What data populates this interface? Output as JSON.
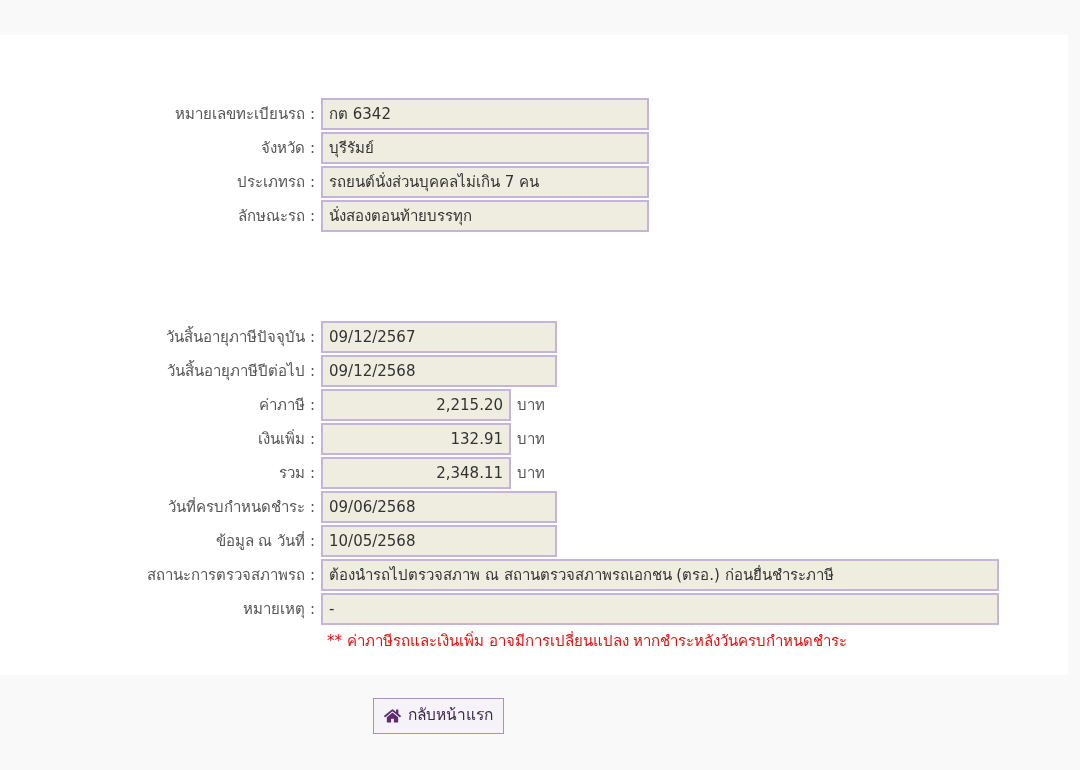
{
  "vehicle": {
    "fields": [
      {
        "label": "หมายเลขทะเบียนรถ :",
        "value": "กต 6342",
        "kind": "medium"
      },
      {
        "label": "จังหวัด :",
        "value": "บุรีรัมย์",
        "kind": "medium"
      },
      {
        "label": "ประเภทรถ :",
        "value": "รถยนต์นั่งส่วนบุคคลไม่เกิน 7 คน",
        "kind": "medium"
      },
      {
        "label": "ลักษณะรถ :",
        "value": "นั่งสองตอนท้ายบรรทุก",
        "kind": "medium"
      }
    ]
  },
  "tax": {
    "fields": [
      {
        "label": "วันสิ้นอายุภาษีปัจจุบัน :",
        "value": "09/12/2567",
        "kind": "date"
      },
      {
        "label": "วันสิ้นอายุภาษีปีต่อไป :",
        "value": "09/12/2568",
        "kind": "date"
      },
      {
        "label": "ค่าภาษี :",
        "value": "2,215.20",
        "kind": "amount",
        "unit": "บาท"
      },
      {
        "label": "เงินเพิ่ม :",
        "value": "132.91",
        "kind": "amount",
        "unit": "บาท"
      },
      {
        "label": "รวม :",
        "value": "2,348.11",
        "kind": "amount",
        "unit": "บาท"
      },
      {
        "label": "วันที่ครบกำหนดชำระ :",
        "value": "09/06/2568",
        "kind": "date"
      },
      {
        "label": "ข้อมูล ณ วันที่ :",
        "value": "10/05/2568",
        "kind": "date"
      },
      {
        "label": "สถานะการตรวจสภาพรถ :",
        "value": "ต้องนำรถไปตรวจสภาพ ณ สถานตรวจสภาพรถเอกชน (ตรอ.) ก่อนยื่นชำระภาษี",
        "kind": "long"
      },
      {
        "label": "หมายเหตุ :",
        "value": "-",
        "kind": "long"
      }
    ],
    "note": "** ค่าภาษีรถและเงินเพิ่ม อาจมีการเปลี่ยนแปลง หากชำระหลังวันครบกำหนดชำระ"
  },
  "home_button": {
    "label": "กลับหน้าแรก"
  }
}
